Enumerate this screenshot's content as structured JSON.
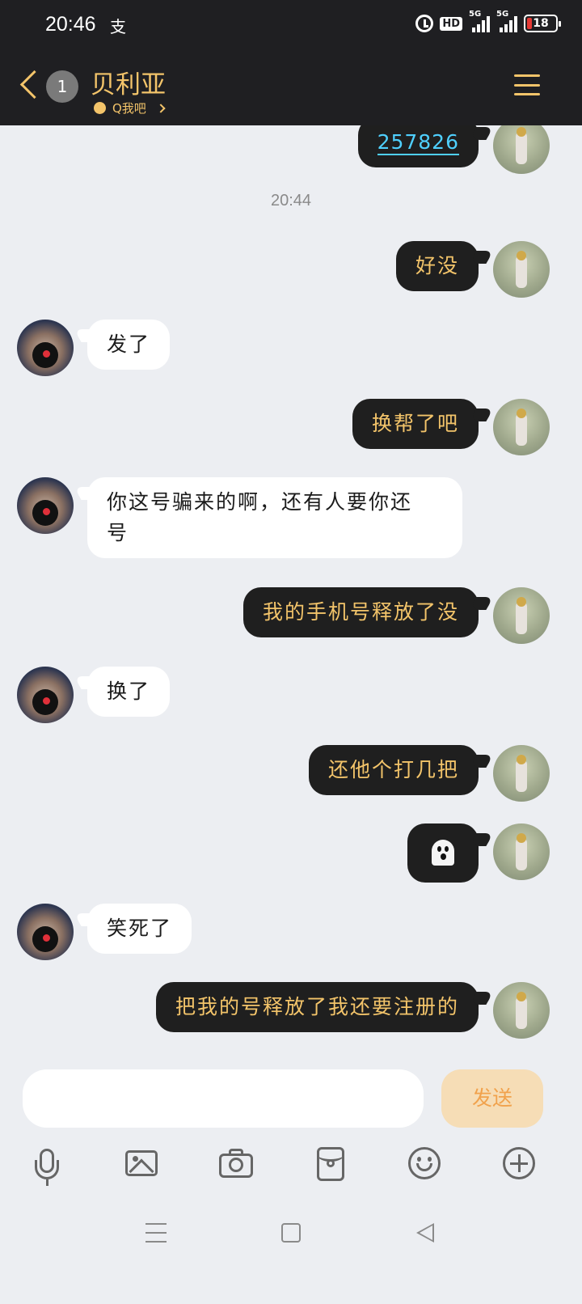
{
  "status_bar": {
    "time": "20:46",
    "app_indicator": "支",
    "hd_label": "HD",
    "signal1_label": "5G",
    "signal2_label": "5G",
    "battery_level": "18"
  },
  "header": {
    "unread_count": "1",
    "title": "贝利亚",
    "subtitle": "Q我吧"
  },
  "messages": [
    {
      "sender": "me",
      "text": "257826",
      "kind": "code"
    },
    {
      "sender": "system",
      "text": "20:44",
      "kind": "timestamp"
    },
    {
      "sender": "me",
      "text": "好没"
    },
    {
      "sender": "other",
      "text": "发了"
    },
    {
      "sender": "me",
      "text": "换帮了吧"
    },
    {
      "sender": "other",
      "text_line1": "你这号骗来的啊，还有人要你还",
      "text_line2": "号"
    },
    {
      "sender": "me",
      "text": "我的手机号释放了没"
    },
    {
      "sender": "other",
      "text": "换了"
    },
    {
      "sender": "me",
      "text": "还他个打几把"
    },
    {
      "sender": "me",
      "kind": "emoji",
      "icon": "ghost-emoji"
    },
    {
      "sender": "other",
      "text": "笑死了"
    },
    {
      "sender": "me",
      "text": "把我的号释放了我还要注册的"
    }
  ],
  "composer": {
    "input_value": "",
    "send_label": "发送"
  },
  "colors": {
    "header_bg": "#1f1f22",
    "accent_gold": "#f3c46a",
    "my_bubble": "#1f1f1f",
    "their_bubble": "#ffffff",
    "code_link": "#4fd0ff",
    "send_button_bg": "#f6ddb6",
    "send_button_text": "#f1a24c"
  }
}
